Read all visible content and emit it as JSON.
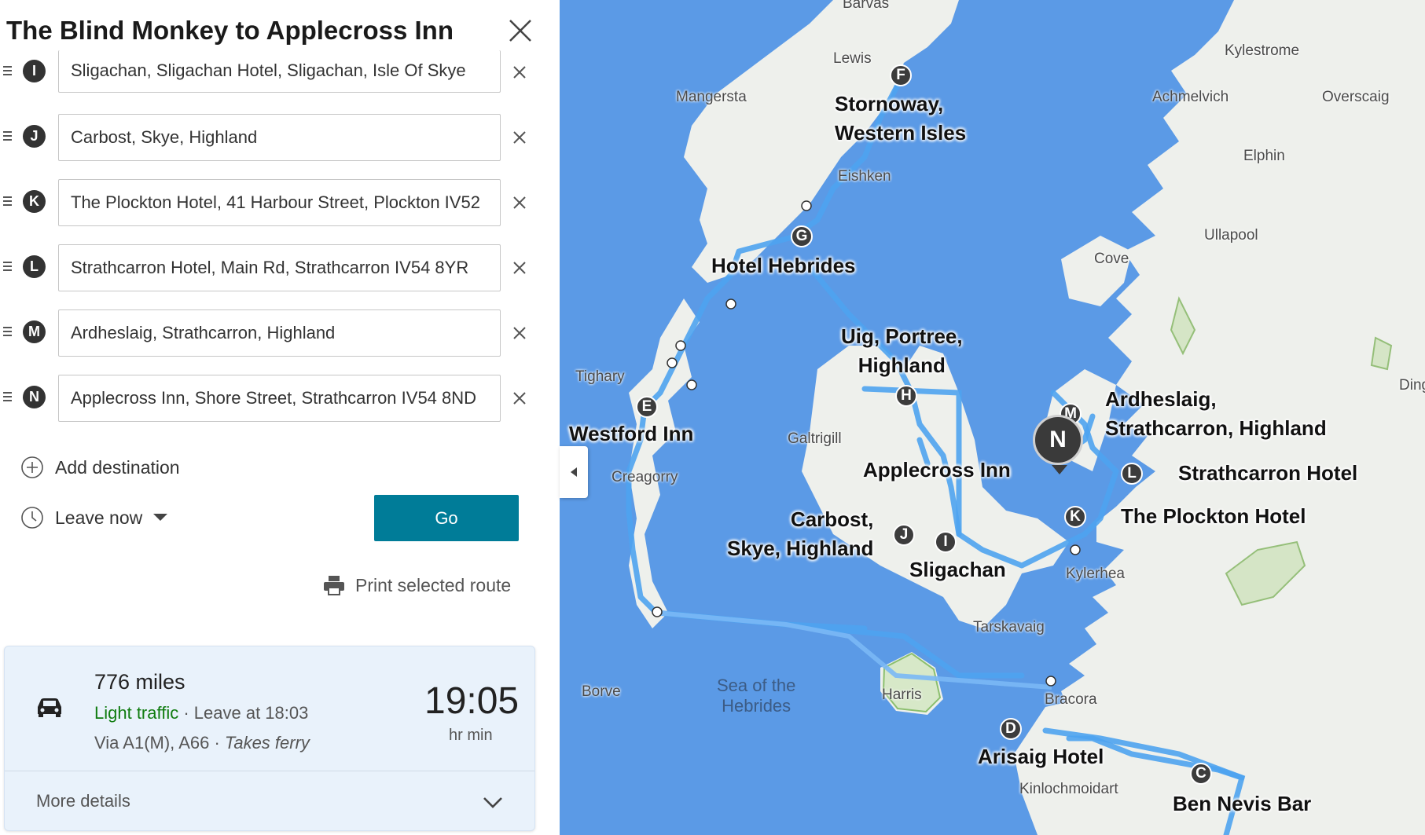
{
  "panel": {
    "title": "The Blind Monkey to Applecross Inn",
    "waypoints": [
      {
        "letter": "I",
        "value": "Sligachan, Sligachan Hotel, Sligachan, Isle Of Skye"
      },
      {
        "letter": "J",
        "value": "Carbost, Skye, Highland"
      },
      {
        "letter": "K",
        "value": "The Plockton Hotel, 41 Harbour Street, Plockton IV52"
      },
      {
        "letter": "L",
        "value": "Strathcarron Hotel, Main Rd, Strathcarron IV54 8YR"
      },
      {
        "letter": "M",
        "value": "Ardheslaig, Strathcarron, Highland"
      },
      {
        "letter": "N",
        "value": "Applecross Inn, Shore Street, Strathcarron IV54 8ND"
      }
    ],
    "add_destination": "Add destination",
    "leave_now": "Leave now",
    "go": "Go",
    "print_route": "Print selected route"
  },
  "route": {
    "distance": "776 miles",
    "traffic": "Light traffic",
    "leave_at": "Leave at 18:03",
    "via": "Via A1(M), A66",
    "ferry": "Takes ferry",
    "time": "19:05",
    "time_unit": "hr min",
    "more_details": "More details"
  },
  "map": {
    "place_labels": [
      "Barvas",
      "Lewis",
      "Mangersta",
      "Eishken",
      "Kylestrome",
      "Achmelvich",
      "Overscaig",
      "Elphin",
      "Ullapool",
      "Cove",
      "Tighary",
      "Galtrigill",
      "Creagorry",
      "Kylerhea",
      "Tarskavaig",
      "Borve",
      "Harris",
      "Bracora",
      "Kinlochmoidart",
      "Ding"
    ],
    "sea_label_1": "Sea of the",
    "sea_label_2": "Hebrides",
    "pois": [
      {
        "letter": "F",
        "label": "Stornoway,\nWestern Isles"
      },
      {
        "letter": "G",
        "label": "Hotel Hebrides"
      },
      {
        "letter": "H",
        "label": "Uig, Portree,\nHighland"
      },
      {
        "letter": "E",
        "label": "Westford Inn"
      },
      {
        "letter": "N",
        "label": "Applecross Inn"
      },
      {
        "letter": "M",
        "label": "Ardheslaig,\nStrathcarron, Highland"
      },
      {
        "letter": "L",
        "label": "Strathcarron Hotel"
      },
      {
        "letter": "K",
        "label": "The Plockton Hotel"
      },
      {
        "letter": "J",
        "label": "Carbost,\nSkye, Highland"
      },
      {
        "letter": "I",
        "label": "Sligachan"
      },
      {
        "letter": "D",
        "label": "Arisaig Hotel"
      },
      {
        "letter": "C",
        "label": "Ben Nevis Bar"
      }
    ]
  },
  "colors": {
    "accent": "#007c98",
    "route": "#4ea3f0",
    "sea": "#5b9ae6",
    "land": "#eef0ec",
    "traffic": "#107c10"
  }
}
